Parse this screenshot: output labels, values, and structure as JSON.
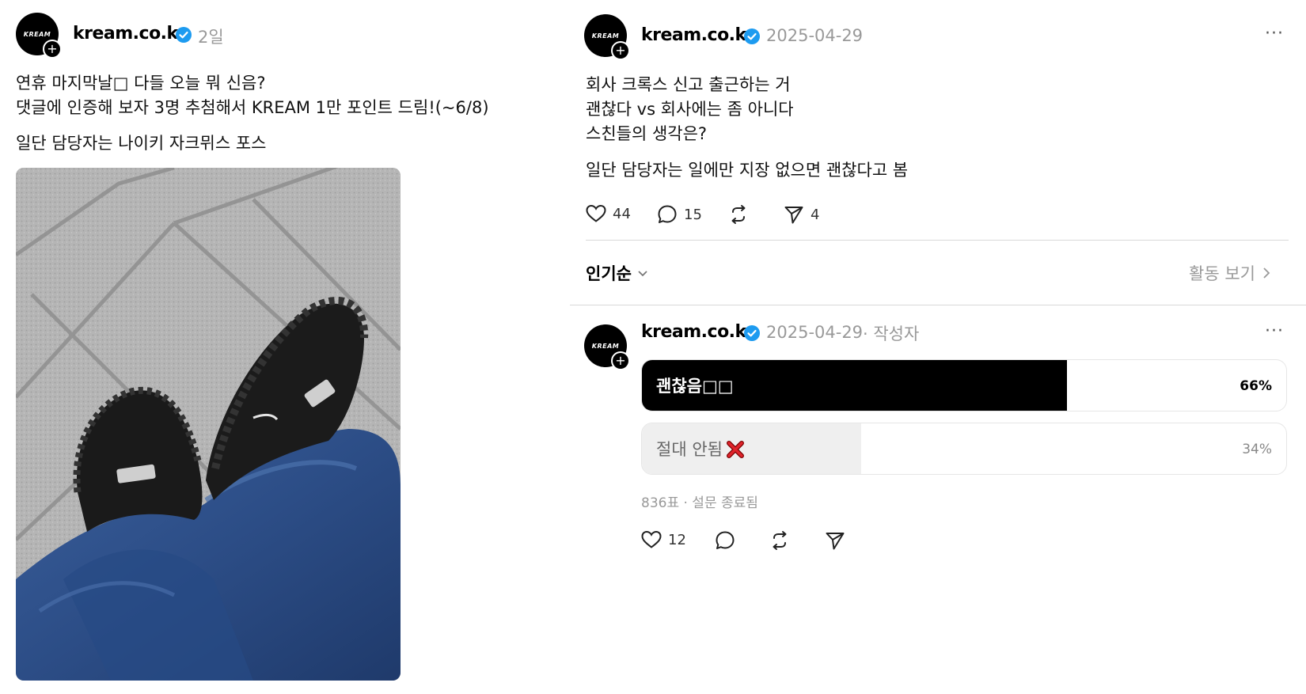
{
  "left_post": {
    "avatar_logo": "KREAM",
    "username": "kream.co.kr",
    "time": "2일",
    "text_line1": "연휴 마지막날□ 다들 오늘 뭐 신음?",
    "text_line2": "댓글에 인증해 보자 3명 추첨해서 KREAM 1만 포인트 드림!(~6/8)",
    "text_line3": "일단 담당자는 나이키 자크뮈스 포스"
  },
  "right_post": {
    "avatar_logo": "KREAM",
    "username": "kream.co.kr",
    "date": "2025-04-29",
    "more_label": "···",
    "text_line1": "회사 크록스 신고 출근하는 거",
    "text_line2": "괜찮다 vs 회사에는 좀 아니다",
    "text_line3": "스친들의 생각은?",
    "text_line4": "일단 담당자는 일에만 지장 없으면 괜찮다고 봄",
    "likes": "44",
    "comments": "15",
    "shares": "4"
  },
  "sort_bar": {
    "sort_label": "인기순",
    "activity_label": "활동 보기"
  },
  "reply": {
    "avatar_logo": "KREAM",
    "username": "kream.co.kr",
    "date": "2025-04-29",
    "author_tag": "· 작성자",
    "more_label": "···",
    "poll": {
      "options": [
        {
          "label": "괜찮음□□",
          "percent_text": "66%",
          "percent": 66,
          "winner": true
        },
        {
          "label": "절대 안됨",
          "percent_text": "34%",
          "percent": 34,
          "winner": false
        }
      ],
      "summary": "836표 · 설문 종료됨"
    },
    "likes": "12"
  },
  "colors": {
    "verified": "#1d9bf0",
    "poll_winner": "#000000",
    "poll_loser": "#efefef",
    "muted_text": "#999999"
  }
}
